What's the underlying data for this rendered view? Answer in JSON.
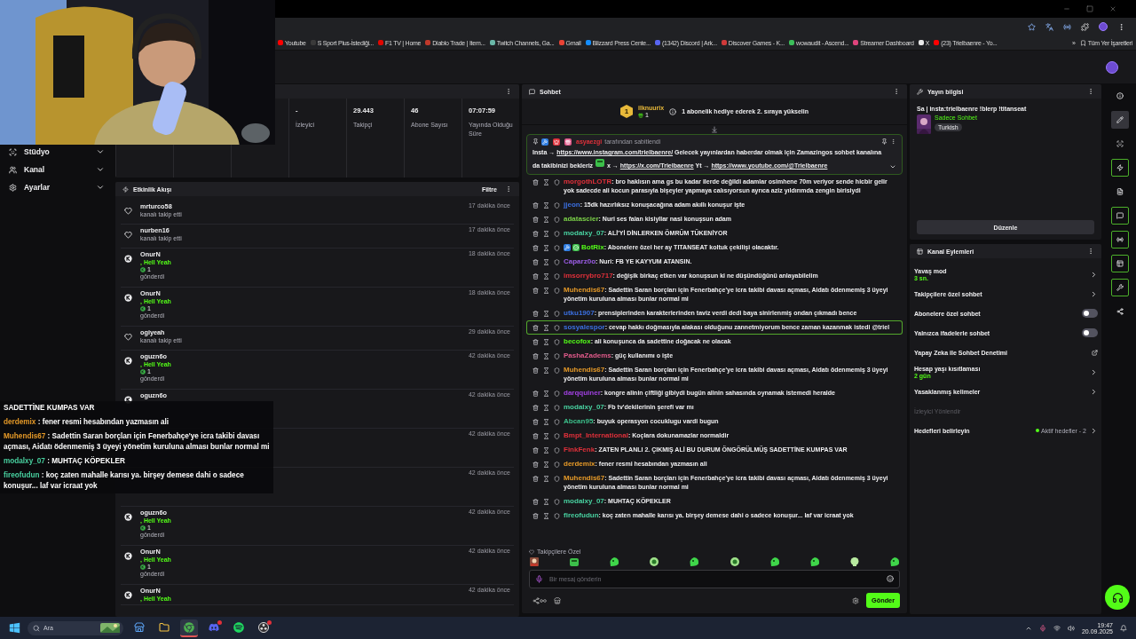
{
  "bookmarks": [
    {
      "title": "Youtube",
      "color": "#ff0000"
    },
    {
      "title": "S Sport Plus-İstediği...",
      "color": "#3a3a3a"
    },
    {
      "title": "F1 TV | Home",
      "color": "#e10600"
    },
    {
      "title": "Diablo Trade | Item...",
      "color": "#c0392b"
    },
    {
      "title": "Twitch Channels, Ga...",
      "color": "#6ab7a8"
    },
    {
      "title": "Gmail",
      "color": "#ea4335"
    },
    {
      "title": "Blizzard Press Cente...",
      "color": "#148eff"
    },
    {
      "title": "(1342) Discord | Ark...",
      "color": "#5865f2"
    },
    {
      "title": "Discover Games - K...",
      "color": "#d03a3a"
    },
    {
      "title": "wowaudit - Ascend...",
      "color": "#3cbf5a"
    },
    {
      "title": "Streamer Dashboard",
      "color": "#e0447c"
    },
    {
      "title": "X",
      "color": "#e8e8e8"
    },
    {
      "title": "(23) Trielbaenre - Yo...",
      "color": "#ff0000"
    }
  ],
  "bookmarks_more": "»",
  "all_bookmarks": "Tüm Yer İşaretleri",
  "sidebar": {
    "items": [
      {
        "kind": "studio",
        "label": "Stüdyo",
        "expanded": false
      },
      {
        "kind": "channel",
        "label": "Kanal",
        "expanded": false
      },
      {
        "kind": "settings",
        "label": "Ayarlar",
        "expanded": false
      }
    ]
  },
  "stats": [
    {
      "value": "-",
      "label": "İzleyici"
    },
    {
      "value": "29.443",
      "label": "Takipçi"
    },
    {
      "value": "46",
      "label": "Abone Sayısı"
    },
    {
      "value": "07:07:59",
      "label": "Yayında Olduğu Süre"
    }
  ],
  "activity_feed": {
    "title": "Etkinlik Akışı",
    "filter": "Filtre",
    "items": [
      {
        "kind": "follow",
        "user": "mrturco58",
        "action": "kanalı takip etti",
        "time": "17 dakika önce"
      },
      {
        "kind": "follow",
        "user": "nurben16",
        "action": "kanalı takip etti",
        "time": "17 dakika önce"
      },
      {
        "kind": "gift",
        "user": "OnurN",
        "reward": ", Hell Yeah",
        "amount": "1",
        "action": "gönderdi",
        "time": "18 dakika önce"
      },
      {
        "kind": "gift",
        "user": "OnurN",
        "reward": ", Hell Yeah",
        "amount": "1",
        "action": "gönderdi",
        "time": "18 dakika önce"
      },
      {
        "kind": "follow",
        "user": "ogiyeah",
        "action": "kanalı takip etti",
        "time": "29 dakika önce"
      },
      {
        "kind": "gift",
        "user": "oguzn6o",
        "reward": ", Hell Yeah",
        "amount": "1",
        "action": "gönderdi",
        "time": "42 dakika önce"
      },
      {
        "kind": "gift",
        "user": "oguzn6o",
        "time": "42 dakika önce"
      },
      {
        "kind": "gift",
        "time": "42 dakika önce"
      },
      {
        "kind": "gift",
        "time": "42 dakika önce"
      },
      {
        "kind": "gift",
        "user": "oguzn6o",
        "reward": ", Hell Yeah",
        "amount": "1",
        "action": "gönderdi",
        "time": "42 dakika önce"
      },
      {
        "kind": "gift",
        "user": "OnurN",
        "reward": ", Hell Yeah",
        "amount": "1",
        "action": "gönderdi",
        "time": "42 dakika önce"
      },
      {
        "kind": "gift",
        "user": "OnurN",
        "reward": ", Hell Yeah",
        "time": "42 dakika önce"
      }
    ]
  },
  "stream_overlay": [
    {
      "text": "SADETTİNE KUMPAS VAR"
    },
    {
      "user": "derdemix",
      "color": "#e69a28",
      "text": " : fener resmi hesabından yazmasın ali"
    },
    {
      "user": "Muhendis67",
      "color": "#e69a28",
      "text": " : Sadettin Saran borçları için Fenerbahçe'ye icra takibi davası açması, Aidatı ödenmemiş 3 üyeyi yönetim kuruluna alması bunlar normal mi"
    },
    {
      "user": "modalxy_07",
      "color": "#48d1a0",
      "text": " : MUHTAÇ KÖPEKLER"
    },
    {
      "user": "fireofudun",
      "color": "#48d1a0",
      "text": " : koç zaten mahalle karısı ya. birşey demese dahi o sadece konuşur... laf var icraat yok"
    }
  ],
  "chat": {
    "title": "Sohbet",
    "leaderboard": {
      "rank": "1",
      "user": "ilknuurix",
      "gifts": "1",
      "hint": "1 abonelik hediye ederek 2. sıraya yükselin"
    },
    "pinned": {
      "badges": [
        {
          "kind": "moderator"
        },
        {
          "kind": "vip"
        },
        {
          "kind": "gift"
        }
      ],
      "pinned_by": "asyaezgi",
      "label": "tarafından sabitlendi",
      "segments": [
        {
          "kind": "text",
          "text": "Insta →"
        },
        {
          "kind": "link",
          "text": "https://www.instagram.com/trielbaenre/"
        },
        {
          "kind": "text",
          "text": "Gelecek yayınlardan haberdar olmak için Zamazingos sohbet kanalına da takibinizi bekleriz"
        },
        {
          "kind": "emote"
        },
        {
          "kind": "text",
          "text": "x →"
        },
        {
          "kind": "link",
          "text": "https://x.com/Trielbaenre"
        },
        {
          "kind": "text",
          "text": "Yt →"
        },
        {
          "kind": "link",
          "text": "https://www.youtube.com/@Trielbaenre"
        }
      ]
    },
    "messages": [
      {
        "user": "morgothLOTR",
        "color": "#e0303a",
        "text": ": bro haklısın ama gs bu kadar ilerde değildi adamlar osimhene 70m veriyor sende hicbir gelir yok sadecde ali kocun parasıyla bişeyler yapmaya calısıyorsun ayrıca aziz yıldırımda zengin birisiydi",
        "highlighted": false
      },
      {
        "user": "jjeon",
        "color": "#3b6fe0",
        "text": ": 15dk hazırlıksız konuşacağına adam akıllı konuşur işte",
        "highlighted": false
      },
      {
        "user": "adatascier",
        "color": "#7bd148",
        "text": ": Nuri ses falan kisiyllar nasi konuşsun adam",
        "highlighted": false
      },
      {
        "user": "modalxy_07",
        "color": "#48d1a0",
        "text": ": ALİ'Yİ DİNLERKEN ÖMRÜM TÜKENİYOR",
        "highlighted": false
      },
      {
        "user": "BotRix",
        "color": "#53fc18",
        "badges": [
          {
            "kind": "moderator"
          },
          {
            "kind": "verified"
          }
        ],
        "text": ": Abonelere özel her ay TITANSEAT koltuk çekilişi olacaktır.",
        "highlighted": false
      },
      {
        "user": "Caparz0o",
        "color": "#9b5de5",
        "text": ": Nuri: FB YE KAYYUM ATANSIN.",
        "highlighted": false
      },
      {
        "user": "imsorrybro717",
        "color": "#e0303a",
        "text": ": değişik birkaç etken var konuşsun ki ne düşündüğünü anlayabilelim",
        "highlighted": false
      },
      {
        "user": "Muhendis67",
        "color": "#e69a28",
        "text": ": Sadettin Saran borçları için Fenerbahçe'ye icra takibi davası açması, Aidatı ödenmemiş 3 üyeyi yönetim kuruluna alması bunlar normal mi",
        "highlighted": false
      },
      {
        "user": "utku1907",
        "color": "#3b6fe0",
        "text": ": prensiplerinden karakterlerinden taviz verdi dedi baya sinirlenmiş ondan çıkmadı bence",
        "highlighted": false
      },
      {
        "user": "sosyalespor",
        "color": "#3b6fe0",
        "text": ": cevap hakkı doğmasıyla alakası olduğunu zannetmiyorum bence zaman kazanmak istedi @triel",
        "highlighted": true
      },
      {
        "user": "becofox",
        "color": "#53fc18",
        "text": ": ali konuşunca da sadettine doğacak ne olacak",
        "highlighted": false
      },
      {
        "user": "PashaZadems",
        "color": "#e05a8a",
        "text": ": güç kullanımı o işte",
        "highlighted": false
      },
      {
        "user": "Muhendis67",
        "color": "#e69a28",
        "text": ": Sadettin Saran borçları için Fenerbahçe'ye icra takibi davası açması, Aidatı ödenmemiş 3 üyeyi yönetim kuruluna alması bunlar normal mi",
        "highlighted": false
      },
      {
        "user": "darqquiner",
        "color": "#a040e0",
        "text": ": kongre alinin çiftliği gibiydi bugün alinin sahasında oynamak istemedi heralde",
        "highlighted": false
      },
      {
        "user": "modalxy_07",
        "color": "#48d1a0",
        "text": ": Fb tv'dekilerinin şerefi var mı",
        "highlighted": false
      },
      {
        "user": "Abcan95",
        "color": "#3cbf8a",
        "text": ": buyuk operasyon cocuklugu vardi bugun",
        "highlighted": false
      },
      {
        "user": "Bmpt_International",
        "color": "#e0303a",
        "text": ": Koçlara dokunamazlar normaldir",
        "highlighted": false
      },
      {
        "user": "FinkFenk",
        "color": "#e0303a",
        "text": ": ZATEN PLANLI 2. ÇIKMIŞ ALİ BU DURUM ÖNGÖRÜLMÜŞ SADETTİNE KUMPAS VAR",
        "highlighted": false
      },
      {
        "user": "derdemix",
        "color": "#e69a28",
        "text": ": fener resmi hesabından yazmasın ali",
        "highlighted": false
      },
      {
        "user": "Muhendis67",
        "color": "#e69a28",
        "text": ": Sadettin Saran borçları için Fenerbahçe'ye icra takibi davası açması, Aidatı ödenmemiş 3 üyeyi yönetim kuruluna alması bunlar normal mi",
        "highlighted": false
      },
      {
        "user": "modalxy_07",
        "color": "#48d1a0",
        "text": ": MUHTAÇ KÖPEKLER",
        "highlighted": false
      },
      {
        "user": "fireofudun",
        "color": "#48d1a0",
        "text": ": koç zaten mahalle karısı ya. birşey demese dahi o sadece konuşur... laf var icraat yok",
        "highlighted": false
      }
    ],
    "emote_section": "Takipçilere Özel",
    "emotes": [
      {
        "kind": "portrait"
      },
      {
        "kind": "frog"
      },
      {
        "kind": "blob"
      },
      {
        "kind": "robot"
      },
      {
        "kind": "blob"
      },
      {
        "kind": "robot"
      },
      {
        "kind": "blob"
      },
      {
        "kind": "blob"
      },
      {
        "kind": "skull"
      },
      {
        "kind": "blob"
      }
    ],
    "input": {
      "placeholder": "Bir mesaj gönderin"
    },
    "send": "Gönder"
  },
  "stream_info": {
    "title": "Yayın bilgisi",
    "stream_title": "Sa | insta:trielbaenre !blerp !titanseat",
    "category": "Sadece Sohbet",
    "tags": [
      "Turkish"
    ],
    "edit": "Düzenle"
  },
  "channel_actions": {
    "title": "Kanal Eylemleri",
    "items": [
      {
        "kind": "link",
        "label": "Yavaş mod",
        "value": "3 sn.",
        "disabled": false
      },
      {
        "kind": "link",
        "label": "Takipçilere özel sohbet",
        "disabled": false
      },
      {
        "kind": "toggle",
        "label": "Abonelere özel sohbet",
        "on": false,
        "disabled": false
      },
      {
        "kind": "toggle",
        "label": "Yalnızca ifadelerle sohbet",
        "on": false,
        "disabled": false
      },
      {
        "kind": "external",
        "label": "Yapay Zeka ile Sohbet Denetimi",
        "disabled": false
      },
      {
        "kind": "link",
        "label": "Hesap yaşı kısıtlaması",
        "value": "2 gün",
        "disabled": false
      },
      {
        "kind": "link",
        "label": "Yasaklanmış kelimeler",
        "disabled": false
      },
      {
        "kind": "plain",
        "label": "İzleyici Yönlendir",
        "disabled": true
      },
      {
        "kind": "link",
        "label": "Hedefleri belirleyin",
        "status": "Aktif hedefler - 2",
        "disabled": false
      }
    ]
  },
  "rail": [
    {
      "kind": "info",
      "selected": false,
      "active": false
    },
    {
      "kind": "edit",
      "selected": true,
      "active": false
    },
    {
      "kind": "camera",
      "selected": false,
      "active": false
    },
    {
      "kind": "events",
      "selected": false,
      "active": true
    },
    {
      "kind": "notes",
      "selected": false,
      "active": false
    },
    {
      "kind": "chat",
      "selected": false,
      "active": true
    },
    {
      "kind": "broadcast",
      "selected": false,
      "active": true
    },
    {
      "kind": "layout",
      "selected": false,
      "active": true
    },
    {
      "kind": "tools",
      "selected": false,
      "active": true
    },
    {
      "kind": "share",
      "selected": false,
      "active": false
    }
  ],
  "taskbar": {
    "search": "Ara",
    "apps": [
      {
        "kind": "store",
        "active": false,
        "notification": false
      },
      {
        "kind": "files",
        "active": false,
        "notification": false
      },
      {
        "kind": "chrome",
        "active": true,
        "notification": false
      },
      {
        "kind": "discord",
        "active": false,
        "notification": true
      },
      {
        "kind": "spotify",
        "active": false,
        "notification": false
      },
      {
        "kind": "obs",
        "active": false,
        "notification": true
      }
    ],
    "time": "19:47",
    "date": "20.09.2025"
  }
}
